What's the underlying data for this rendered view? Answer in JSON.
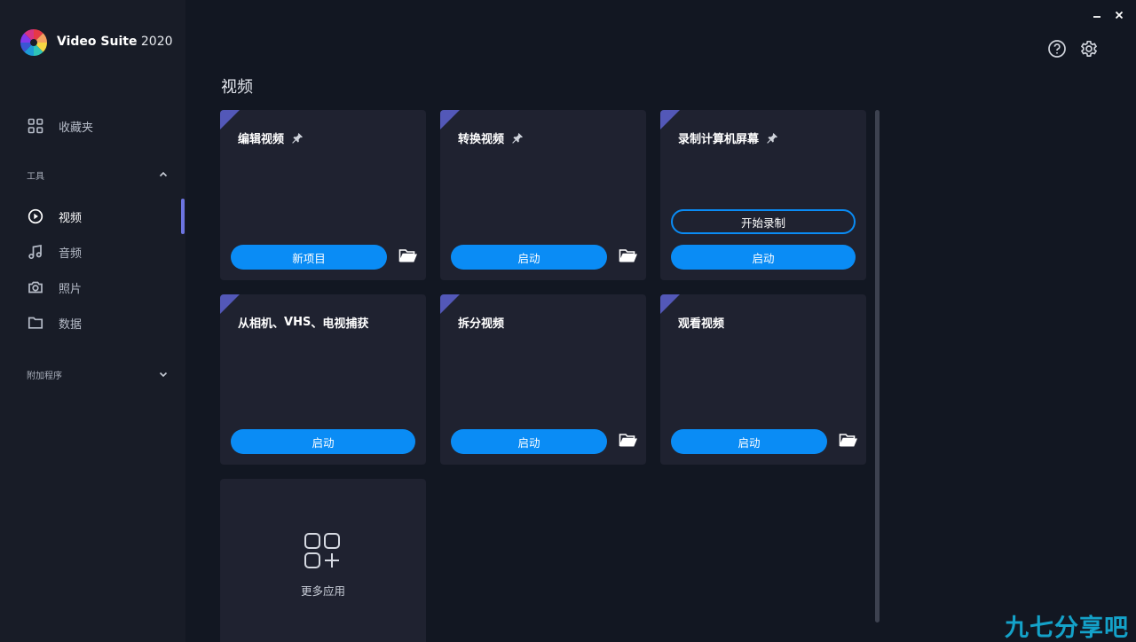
{
  "app": {
    "name": "Video Suite",
    "year": "2020"
  },
  "window_controls": {
    "minimize_icon": "minimize-icon",
    "close_icon": "close-icon"
  },
  "sidebar": {
    "favorites_label": "收藏夹",
    "tools_section": "工具",
    "items": [
      {
        "label": "视频",
        "icon": "play-circle-icon",
        "active": true
      },
      {
        "label": "音频",
        "icon": "music-note-icon",
        "active": false
      },
      {
        "label": "照片",
        "icon": "camera-icon",
        "active": false
      },
      {
        "label": "数据",
        "icon": "folder-icon",
        "active": false
      }
    ],
    "addons_section": "附加程序"
  },
  "header": {
    "help_icon": "help-icon",
    "settings_icon": "gear-icon"
  },
  "main": {
    "title": "视频",
    "cards": [
      {
        "title": "编辑视频",
        "pinned": true,
        "primary_label": "新项目",
        "has_folder": true
      },
      {
        "title": "转换视频",
        "pinned": true,
        "primary_label": "启动",
        "has_folder": true
      },
      {
        "title": "录制计算机屏幕",
        "pinned": true,
        "secondary_label": "开始录制",
        "primary_label": "启动",
        "has_folder": false
      },
      {
        "title_parts": [
          "从相机、",
          "VHS",
          "、电视捕获"
        ],
        "pinned": false,
        "primary_label": "启动",
        "has_folder": false
      },
      {
        "title": "拆分视频",
        "pinned": false,
        "primary_label": "启动",
        "has_folder": true
      },
      {
        "title": "观看视频",
        "pinned": false,
        "primary_label": "启动",
        "has_folder": true
      }
    ],
    "more_apps_label": "更多应用"
  },
  "watermark": "九七分享吧",
  "colors": {
    "accent": "#0a8cf5",
    "corner_tag": "#5358b8",
    "active_bar": "#6c74e0",
    "watermark": "#14a2c9"
  }
}
